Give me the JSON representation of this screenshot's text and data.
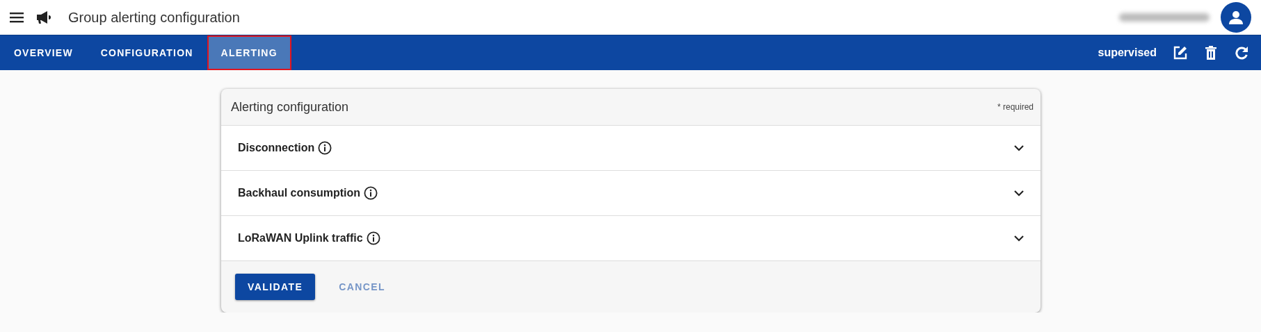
{
  "app_bar": {
    "title": "Group alerting configuration"
  },
  "tabs": [
    {
      "label": "OVERVIEW",
      "selected": false,
      "outlined": false
    },
    {
      "label": "CONFIGURATION",
      "selected": false,
      "outlined": false
    },
    {
      "label": "ALERTING",
      "selected": true,
      "outlined": true
    }
  ],
  "status": "supervised",
  "card": {
    "title": "Alerting configuration",
    "required_note": "* required",
    "sections": [
      {
        "label": "Disconnection",
        "expanded": false
      },
      {
        "label": "Backhaul consumption",
        "expanded": false
      },
      {
        "label": "LoRaWAN Uplink traffic",
        "expanded": false
      }
    ],
    "buttons": [
      {
        "label": "VALIDATE",
        "kind": "primary",
        "disabled": false
      },
      {
        "label": "CANCEL",
        "kind": "text",
        "disabled": true
      }
    ]
  }
}
